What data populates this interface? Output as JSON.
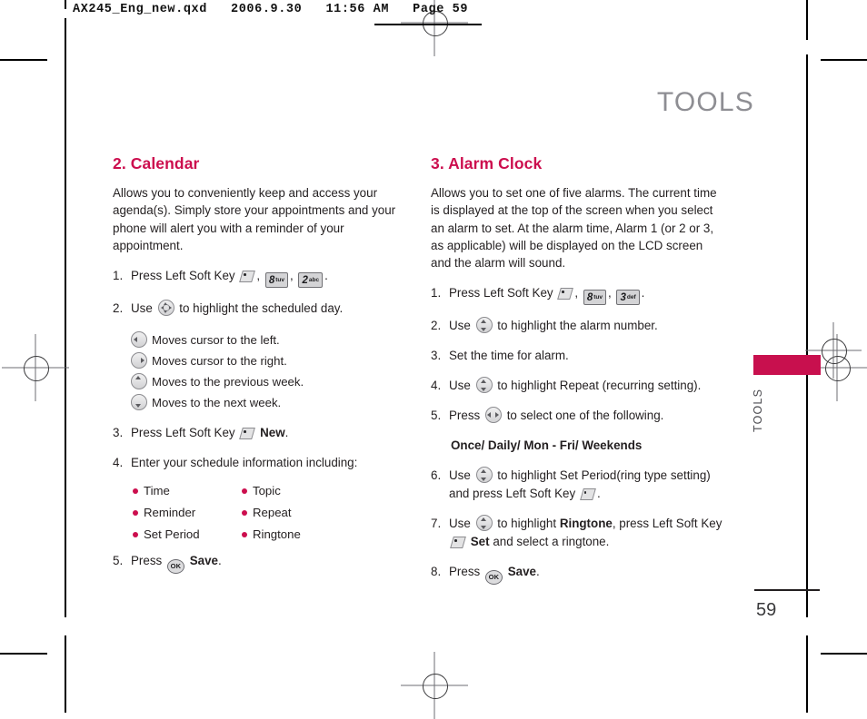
{
  "slug": {
    "text": "AX245_Eng_new.qxd   2006.9.30   11:56 AM   Page 59"
  },
  "running_head": "TOOLS",
  "side_tab": {
    "label": "TOOLS",
    "color": "#c8104e"
  },
  "folio": "59",
  "theme": {
    "heading_color": "#cc0e4e",
    "bullet_color": "#cc0e4e",
    "body_color": "#231f20",
    "running_head_color": "#8e8e93"
  },
  "left_column": {
    "title": "2. Calendar",
    "intro": "Allows you to conveniently keep and access your agenda(s). Simply store your appointments and your phone will alert you with a reminder of your appointment.",
    "step1": {
      "num": "1.",
      "lead": "Press Left Soft Key",
      "comma1": ",",
      "key1_digit": "8",
      "key1_sub": "tuv",
      "comma2": ",",
      "key2_digit": "2",
      "key2_sub": "abc",
      "end": "."
    },
    "step2": {
      "num": "2.",
      "lead": "Use",
      "tail": "to highlight the scheduled day."
    },
    "arrow_items": [
      {
        "icon": "nav-left-icon",
        "text": "Moves cursor to the left."
      },
      {
        "icon": "nav-right-icon",
        "text": "Moves cursor to the right."
      },
      {
        "icon": "nav-up-icon",
        "text": "Moves to the previous week."
      },
      {
        "icon": "nav-down-icon",
        "text": "Moves to the next week."
      }
    ],
    "step3": {
      "num": "3.",
      "lead": "Press Left Soft Key",
      "bold": "New",
      "end": "."
    },
    "step4": {
      "num": "4.",
      "text": "Enter your schedule information including:"
    },
    "bullets": [
      "Time",
      "Topic",
      "Reminder",
      "Repeat",
      "Set Period",
      "Ringtone"
    ],
    "step5": {
      "num": "5.",
      "lead": "Press",
      "bold": "Save",
      "end": "."
    }
  },
  "right_column": {
    "title": "3. Alarm Clock",
    "intro": "Allows you to set one of five alarms. The current time is displayed at the top of the screen when you select an alarm to set. At the alarm time, Alarm 1 (or 2 or 3, as applicable) will be displayed on the LCD screen and the alarm will sound.",
    "step1": {
      "num": "1.",
      "lead": "Press Left Soft Key",
      "comma1": ",",
      "key1_digit": "8",
      "key1_sub": "tuv",
      "comma2": ",",
      "key2_digit": "3",
      "key2_sub": "def",
      "end": "."
    },
    "step2": {
      "num": "2.",
      "lead": "Use",
      "tail": "to highlight the alarm number."
    },
    "step3": {
      "num": "3.",
      "text": "Set the time for alarm."
    },
    "step4": {
      "num": "4.",
      "lead": "Use",
      "tail": "to highlight Repeat (recurring setting)."
    },
    "step5": {
      "num": "5.",
      "lead": "Press",
      "tail": "to select one of the following."
    },
    "options": "Once/ Daily/ Mon - Fri/ Weekends",
    "step6": {
      "num": "6.",
      "lead": "Use",
      "mid": "to highlight Set Period(ring type setting) and press Left Soft Key",
      "end": "."
    },
    "step7": {
      "num": "7.",
      "lead": "Use",
      "mid": "to highlight",
      "bold1": "Ringtone",
      "mid2": ", press Left Soft Key",
      "bold2": "Set",
      "end": "and select a ringtone."
    },
    "step8": {
      "num": "8.",
      "lead": "Press",
      "bold": "Save",
      "end": "."
    }
  }
}
